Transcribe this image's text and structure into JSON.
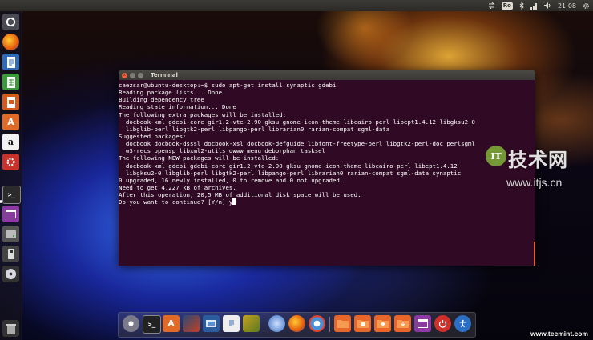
{
  "top_panel": {
    "keyboard_layout": "Ro",
    "time": "21:08",
    "icons": [
      "transfer-icon",
      "keyboard-icon",
      "bluetooth-icon",
      "network-icon",
      "volume-icon",
      "gear-icon"
    ]
  },
  "launcher": {
    "items": [
      {
        "name": "dash-home",
        "icon": "ubuntu-logo-icon"
      },
      {
        "name": "firefox",
        "icon": "firefox-icon"
      },
      {
        "name": "libreoffice-writer",
        "icon": "document-icon"
      },
      {
        "name": "libreoffice-calc",
        "icon": "spreadsheet-icon"
      },
      {
        "name": "libreoffice-impress",
        "icon": "presentation-icon"
      },
      {
        "name": "software-center",
        "icon": "shopping-bag-icon"
      },
      {
        "name": "amazon",
        "icon": "amazon-icon",
        "label": "a"
      },
      {
        "name": "system-settings",
        "icon": "wrench-gear-icon"
      },
      {
        "name": "terminal",
        "icon": "terminal-icon"
      },
      {
        "name": "workspaces",
        "icon": "workspace-icon"
      },
      {
        "name": "disks",
        "icon": "disk-icon"
      },
      {
        "name": "usb",
        "icon": "usb-icon"
      },
      {
        "name": "dvd",
        "icon": "cdrom-icon"
      },
      {
        "name": "trash",
        "icon": "trash-icon"
      }
    ]
  },
  "terminal": {
    "title": "Terminal",
    "lines": [
      "caezsar@ubuntu-desktop:~$ sudo apt-get install synaptic gdebi",
      "Reading package lists... Done",
      "Building dependency tree",
      "Reading state information... Done",
      "The following extra packages will be installed:",
      "  docbook-xml gdebi-core gir1.2-vte-2.90 gksu gnome-icon-theme libcairo-perl libept1.4.12 libgksu2-0",
      "  libglib-perl libgtk2-perl libpango-perl librarian0 rarian-compat sgml-data",
      "Suggested packages:",
      "  docbook docbook-dsssl docbook-xsl docbook-defguide libfont-freetype-perl libgtk2-perl-doc perlsgml",
      "  w3-recs opensp libxml2-utils dwww menu deborphan tasksel",
      "The following NEW packages will be installed:",
      "  docbook-xml gdebi gdebi-core gir1.2-vte-2.90 gksu gnome-icon-theme libcairo-perl libept1.4.12",
      "  libgksu2-0 libglib-perl libgtk2-perl libpango-perl librarian0 rarian-compat sgml-data synaptic",
      "0 upgraded, 16 newly installed, 0 to remove and 0 not upgraded.",
      "Need to get 4.227 kB of archives.",
      "After this operation, 20,5 MB of additional disk space will be used.",
      "Do you want to continue? [Y/n] y"
    ]
  },
  "watermark": {
    "logo_letter": "IT",
    "cn_text": "技术网",
    "url": "www.itjs.cn"
  },
  "dock": {
    "items": [
      {
        "name": "ubuntu",
        "icon": "ubuntu-logo-icon"
      },
      {
        "name": "terminal",
        "icon": "terminal-icon"
      },
      {
        "name": "software-center",
        "icon": "shopping-bag-icon"
      },
      {
        "name": "photos",
        "icon": "photos-icon"
      },
      {
        "name": "screenshot",
        "icon": "screenshot-icon"
      },
      {
        "name": "document-viewer",
        "icon": "document-icon"
      },
      {
        "name": "image-viewer",
        "icon": "image-icon"
      },
      {
        "name": "thunderbird",
        "icon": "mail-icon"
      },
      {
        "name": "firefox",
        "icon": "firefox-icon"
      },
      {
        "name": "chromium",
        "icon": "browser-icon"
      },
      {
        "name": "screen-settings",
        "icon": "monitor-icon"
      },
      {
        "name": "home-folder",
        "icon": "folder-icon"
      },
      {
        "name": "documents-folder",
        "icon": "folder-icon"
      },
      {
        "name": "pictures-folder",
        "icon": "folder-icon"
      },
      {
        "name": "downloads-folder",
        "icon": "folder-icon"
      },
      {
        "name": "workspace-switcher",
        "icon": "workspace-icon"
      },
      {
        "name": "shutdown",
        "icon": "power-icon"
      },
      {
        "name": "accessibility",
        "icon": "accessibility-icon"
      }
    ]
  },
  "site_watermark": "www.tecmint.com",
  "colors": {
    "terminal_bg": "#300a24",
    "titlebar": "#3c3b37",
    "close_button": "#e8623b",
    "accent_orange": "#e2622a"
  }
}
